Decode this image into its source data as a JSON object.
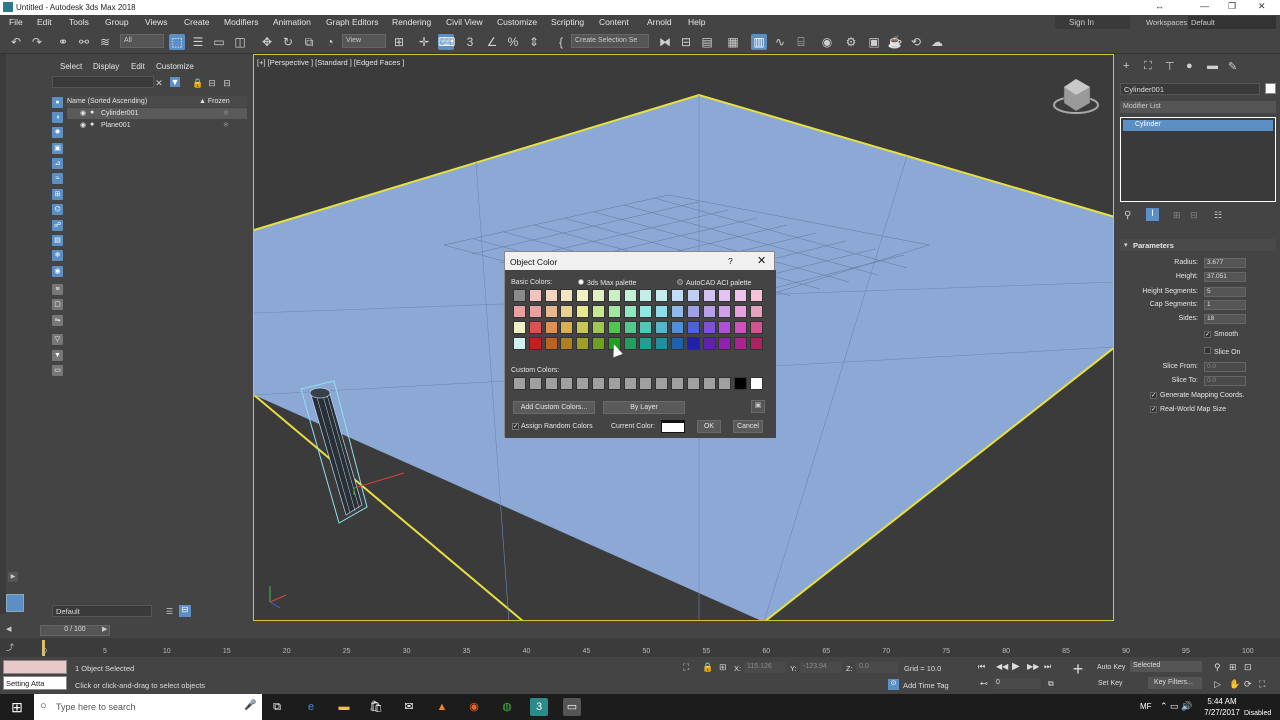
{
  "window": {
    "title": "Untitled - Autodesk 3ds Max 2018",
    "minimize": "—",
    "maximize": "❐",
    "close": "✕",
    "extra": "↔"
  },
  "menu": {
    "items": [
      "File",
      "Edit",
      "Tools",
      "Group",
      "Views",
      "Create",
      "Modifiers",
      "Animation",
      "Graph Editors",
      "Rendering",
      "Civil View",
      "Customize",
      "Scripting",
      "Content",
      "Arnold",
      "Help"
    ],
    "sign_in": "Sign In",
    "workspaces_label": "Workspaces:",
    "workspace_value": "Default"
  },
  "toolbar": {
    "filter_value": "All",
    "refcoord_value": "View",
    "named_selection": "Create Selection Se"
  },
  "scene_explorer": {
    "tabs": [
      "Select",
      "Display",
      "Edit",
      "Customize"
    ],
    "col_name": "Name (Sorted Ascending)",
    "col_frozen": "▲ Frozen",
    "objects": [
      {
        "name": "Cylinder001",
        "selected": true
      },
      {
        "name": "Plane001",
        "selected": false
      }
    ],
    "layer": "Default"
  },
  "viewport": {
    "label": "[+] [Perspective ] [Standard ] [Edged Faces ]"
  },
  "command_panel": {
    "object_name": "Cylinder001",
    "object_color": "#ffffff",
    "modifier_list": "Modifier List",
    "stack_item": "Cylinder",
    "rollout_title": "Parameters",
    "params": [
      {
        "label": "Radius:",
        "value": "3.677",
        "disabled": false
      },
      {
        "label": "Height:",
        "value": "37.051",
        "disabled": false
      },
      {
        "label": "Height Segments:",
        "value": "5",
        "disabled": false
      },
      {
        "label": "Cap Segments:",
        "value": "1",
        "disabled": false
      },
      {
        "label": "Sides:",
        "value": "18",
        "disabled": false
      }
    ],
    "smooth": "Smooth",
    "slice_on": "Slice On",
    "slice_from_label": "Slice From:",
    "slice_from_value": "0.0",
    "slice_to_label": "Slice To:",
    "slice_to_value": "0.0",
    "gen_mapping": "Generate Mapping Coords.",
    "real_world": "Real-World Map Size"
  },
  "timeline": {
    "slider": "0 / 100",
    "ticks": [
      "0",
      "5",
      "10",
      "15",
      "20",
      "25",
      "30",
      "35",
      "40",
      "45",
      "50",
      "55",
      "60",
      "65",
      "70",
      "75",
      "80",
      "85",
      "90",
      "95",
      "100"
    ]
  },
  "status": {
    "script_box": "Setting Atta",
    "selected": "1 Object Selected",
    "hint": "Click or click-and-drag to select objects",
    "x_label": "X:",
    "x_value": "115.126",
    "y_label": "Y:",
    "y_value": "-123.94",
    "z_label": "Z:",
    "z_value": "0.0",
    "grid": "Grid = 10.0",
    "add_time_tag": "Add Time Tag",
    "frame": "0",
    "auto_key": "Auto Key",
    "auto_key_mode": "Selected",
    "set_key": "Set Key",
    "key_filters": "Key Filters..."
  },
  "taskbar": {
    "search": "Type here to search",
    "time": "5:44 AM",
    "date": "7/27/2017",
    "user": "MF",
    "disabled": "Disabled"
  },
  "dialog": {
    "title": "Object Color",
    "help": "?",
    "close": "✕",
    "basic_colors": "Basic Colors:",
    "palette_max": "3ds Max palette",
    "palette_aci": "AutoCAD ACI palette",
    "custom_colors": "Custom Colors:",
    "add_custom": "Add Custom Colors...",
    "by_layer": "By Layer",
    "assign_random": "Assign Random Colors",
    "current_color": "Current Color:",
    "ok": "OK",
    "cancel": "Cancel",
    "basic_rows": [
      [
        "#8a8a8a",
        "#f5c2c2",
        "#f5d4c2",
        "#f5e4c2",
        "#f0f0c2",
        "#e0f0c2",
        "#c8f0c2",
        "#c2f0d4",
        "#c2f0e8",
        "#c2ecf0",
        "#c2dcf5",
        "#c2ccf5",
        "#d4c2f5",
        "#e4c2f5",
        "#f0c2ec",
        "#f5c2d8"
      ],
      [
        "#e8a0a0",
        "#e8a0a0",
        "#e8b890",
        "#e8d090",
        "#e8e890",
        "#c8e890",
        "#a0e8a0",
        "#90e8c0",
        "#90e8e0",
        "#90dce8",
        "#90b8e8",
        "#a0a0e8",
        "#b8a0e8",
        "#d0a0e8",
        "#e8a0e0",
        "#e8a0c0"
      ],
      [
        "#f0f0c8",
        "#e05050",
        "#e09050",
        "#d8b050",
        "#c8c850",
        "#a0c850",
        "#50c850",
        "#50c890",
        "#50c8b8",
        "#50b8c8",
        "#5090d8",
        "#5060d8",
        "#8050d8",
        "#b050d8",
        "#d050c0",
        "#d85090"
      ],
      [
        "#d0f0f0",
        "#c02020",
        "#c06020",
        "#b08020",
        "#a0a020",
        "#70a020",
        "#20a020",
        "#20a060",
        "#20a090",
        "#2090a0",
        "#2060b0",
        "#2020b0",
        "#6020b0",
        "#9020b0",
        "#b02090",
        "#b02060"
      ]
    ],
    "custom_row": [
      "#a0a0a0",
      "#a0a0a0",
      "#a0a0a0",
      "#a0a0a0",
      "#a0a0a0",
      "#a0a0a0",
      "#a0a0a0",
      "#a0a0a0",
      "#a0a0a0",
      "#a0a0a0",
      "#a0a0a0",
      "#a0a0a0",
      "#a0a0a0",
      "#a0a0a0",
      "#000000",
      "#ffffff"
    ]
  },
  "colors": {
    "accent": "#5c8fc4",
    "plane": "#8ba9d4",
    "selection_outline": "#e8e040",
    "viewport_bg": "#3b3b3b"
  }
}
